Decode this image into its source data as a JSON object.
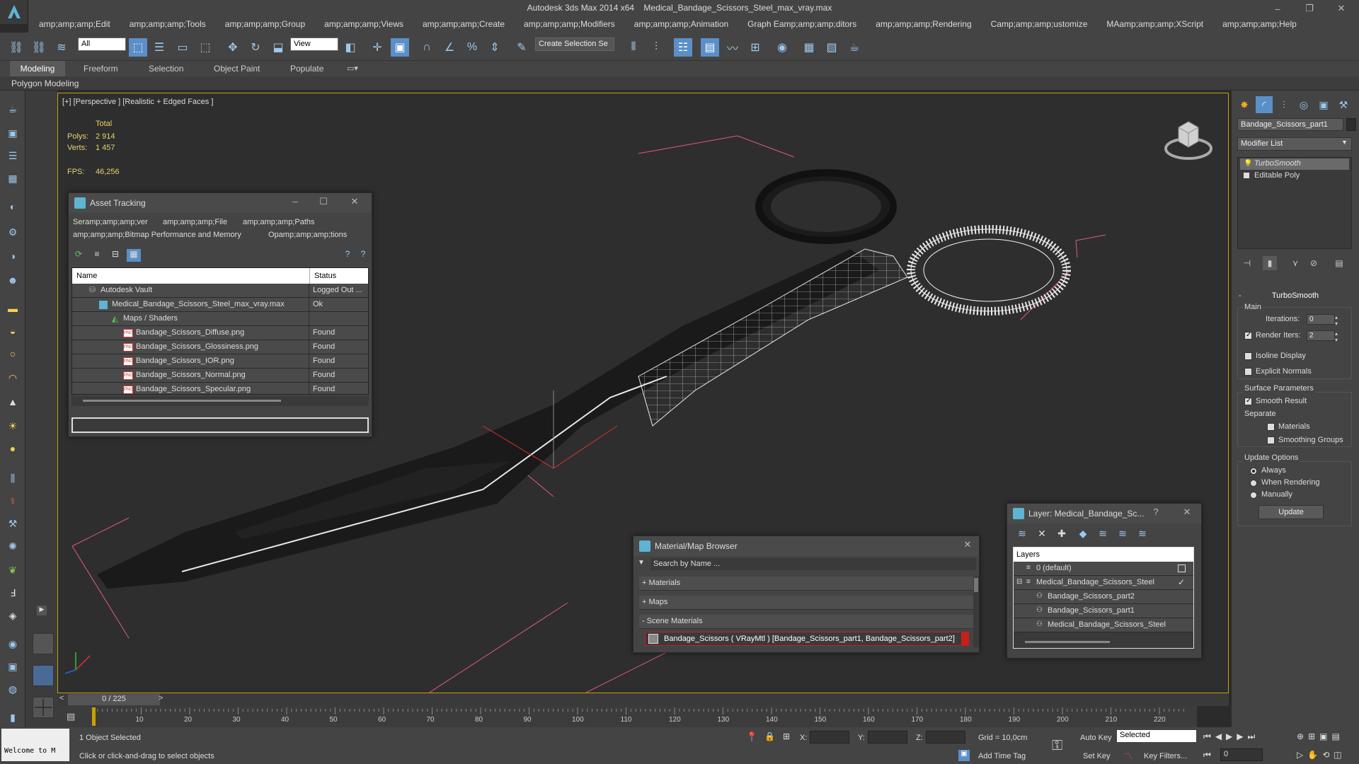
{
  "window": {
    "app_name": "Autodesk 3ds Max  2014 x64",
    "file_name": "Medical_Bandage_Scissors_Steel_max_vray.max",
    "minimize": "–",
    "restore": "❐",
    "close": "✕"
  },
  "menu": [
    "amp;amp;amp;Edit",
    "amp;amp;amp;Tools",
    "amp;amp;amp;Group",
    "amp;amp;amp;Views",
    "amp;amp;amp;Create",
    "amp;amp;amp;Modifiers",
    "amp;amp;amp;Animation",
    "Graph Eamp;amp;amp;ditors",
    "amp;amp;amp;Rendering",
    "Camp;amp;amp;ustomize",
    "MAamp;amp;amp;XScript",
    "amp;amp;amp;Help"
  ],
  "toolbar": {
    "filter_value": "All",
    "refcoord_value": "View",
    "selection_set_placeholder": "Create Selection Se"
  },
  "ribbon": {
    "tabs": [
      "Modeling",
      "Freeform",
      "Selection",
      "Object Paint",
      "Populate"
    ],
    "active_tab": "Modeling",
    "sub_label": "Polygon Modeling"
  },
  "viewport": {
    "label": "[+] [Perspective ] [Realistic + Edged Faces ]",
    "stats_total": "Total",
    "polys_label": "Polys:",
    "polys_value": "2 914",
    "verts_label": "Verts:",
    "verts_value": "1 457",
    "fps_label": "FPS:",
    "fps_value": "46,256"
  },
  "asset_tracking": {
    "title": "Asset Tracking",
    "menu": [
      "Seramp;amp;amp;ver",
      "amp;amp;amp;File",
      "amp;amp;amp;Paths",
      "amp;amp;amp;Bitmap Performance and Memory",
      "Opamp;amp;amp;tions"
    ],
    "col_name": "Name",
    "col_status": "Status",
    "rows": [
      {
        "name": "Autodesk Vault",
        "status": "Logged Out ..."
      },
      {
        "name": "Medical_Bandage_Scissors_Steel_max_vray.max",
        "status": "Ok"
      },
      {
        "name": "Maps / Shaders",
        "status": ""
      },
      {
        "name": "Bandage_Scissors_Diffuse.png",
        "status": "Found"
      },
      {
        "name": "Bandage_Scissors_Glossiness.png",
        "status": "Found"
      },
      {
        "name": "Bandage_Scissors_IOR.png",
        "status": "Found"
      },
      {
        "name": "Bandage_Scissors_Normal.png",
        "status": "Found"
      },
      {
        "name": "Bandage_Scissors_Specular.png",
        "status": "Found"
      }
    ]
  },
  "material_browser": {
    "title": "Material/Map Browser",
    "search_placeholder": "Search by Name ...",
    "sections": [
      "+ Materials",
      "+ Maps",
      "- Scene Materials"
    ],
    "scene_material": "Bandage_Scissors ( VRayMtl ) [Bandage_Scissors_part1, Bandage_Scissors_part2]"
  },
  "layer_window": {
    "title": "Layer: Medical_Bandage_Sc...",
    "help": "?",
    "header": "Layers",
    "rows": [
      "0 (default)",
      "Medical_Bandage_Scissors_Steel",
      "Bandage_Scissors_part2",
      "Bandage_Scissors_part1",
      "Medical_Bandage_Scissors_Steel"
    ]
  },
  "command_panel": {
    "object_name": "Bandage_Scissors_part1",
    "modifier_list": "Modifier List",
    "stack": [
      "TurboSmooth",
      "Editable Poly"
    ],
    "rollout_title": "TurboSmooth",
    "main_label": "Main",
    "iterations_label": "Iterations:",
    "iterations_value": "0",
    "render_iters_label": "Render Iters:",
    "render_iters_value": "2",
    "render_iters_checked": true,
    "isoline_label": "Isoline Display",
    "explicit_normals_label": "Explicit Normals",
    "surface_params_label": "Surface Parameters",
    "smooth_result_label": "Smooth Result",
    "separate_label": "Separate",
    "materials_label": "Materials",
    "smoothing_groups_label": "Smoothing Groups",
    "update_options_label": "Update Options",
    "always_label": "Always",
    "when_rendering_label": "When Rendering",
    "manually_label": "Manually",
    "update_button": "Update"
  },
  "timeline": {
    "frame_counter": "0 / 225",
    "prev": "<",
    "next": ">",
    "ticks": [
      "10",
      "20",
      "30",
      "40",
      "50",
      "60",
      "70",
      "80",
      "90",
      "100",
      "110",
      "120",
      "130",
      "140",
      "150",
      "160",
      "170",
      "180",
      "190",
      "200",
      "210",
      "220"
    ]
  },
  "status": {
    "welcome": "Welcome to M",
    "selection_status": "1 Object Selected",
    "prompt": "Click or click-and-drag to select objects",
    "x_label": "X:",
    "y_label": "Y:",
    "z_label": "Z:",
    "grid": "Grid = 10,0cm",
    "add_time_tag": "Add Time Tag",
    "auto_key": "Auto Key",
    "set_key": "Set Key",
    "selected_value": "Selected",
    "key_filters": "Key Filters...",
    "frame_value": "0"
  },
  "colors": {
    "viewport_border": "#c8a000",
    "stat_text": "#e6d36b",
    "highlight_red": "#c81e1e",
    "bounding_box": "#e05a80"
  }
}
